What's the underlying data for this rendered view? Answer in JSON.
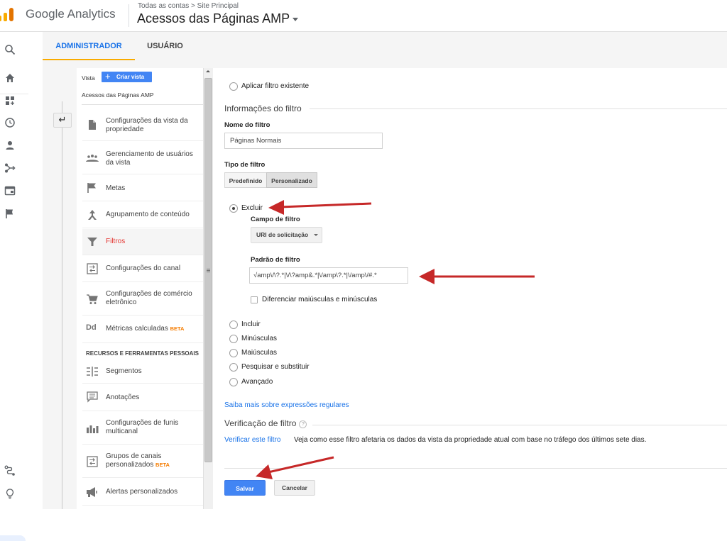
{
  "header": {
    "brand": "Google Analytics",
    "breadcrumb": "Todas as contas > Site Principal",
    "view_title": "Acessos das Páginas AMP"
  },
  "tabs": [
    {
      "label": "ADMINISTRADOR",
      "active": true
    },
    {
      "label": "USUÁRIO",
      "active": false
    }
  ],
  "rail": {
    "icons": [
      "search-icon",
      "home-icon",
      "customization-icon",
      "realtime-clock-icon",
      "audience-person-icon",
      "acquisition-icon",
      "behavior-icon",
      "conversions-flag-icon",
      "attribution-icon",
      "discover-lightbulb-icon"
    ]
  },
  "nav": {
    "vista_label": "Vista",
    "create_view_label": "Criar vista",
    "view_name": "Acessos das Páginas AMP",
    "back_icon": "back-arrow-icon",
    "items": [
      {
        "label": "Configurações da vista da propriedade",
        "icon": "document-icon"
      },
      {
        "label": "Gerenciamento de usuários da vista",
        "icon": "users-group-icon"
      },
      {
        "label": "Metas",
        "icon": "flag-icon"
      },
      {
        "label": "Agrupamento de conteúdo",
        "icon": "content-grouping-icon"
      },
      {
        "label": "Filtros",
        "icon": "filter-icon",
        "active": true
      },
      {
        "label": "Configurações do canal",
        "icon": "channel-settings-icon"
      },
      {
        "label": "Configurações de comércio eletrônico",
        "icon": "cart-icon"
      },
      {
        "label": "Métricas calculadas",
        "icon": "calculated-metrics-icon",
        "badge": "BETA"
      }
    ],
    "section_title": "RECURSOS E FERRAMENTAS PESSOAIS",
    "personal_items": [
      {
        "label": "Segmentos",
        "icon": "segments-icon"
      },
      {
        "label": "Anotações",
        "icon": "annotations-icon"
      },
      {
        "label": "Configurações de funis multicanal",
        "icon": "mcf-chart-icon"
      },
      {
        "label": "Grupos de canais personalizados",
        "icon": "channel-groups-icon",
        "badge": "BETA"
      },
      {
        "label": "Alertas personalizados",
        "icon": "megaphone-icon"
      }
    ]
  },
  "form": {
    "apply_existing_label": "Aplicar filtro existente",
    "info_section_title": "Informações do filtro",
    "filter_name_label": "Nome do filtro",
    "filter_name_value": "Páginas Normais",
    "filter_type_label": "Tipo de filtro",
    "filter_type_options": [
      "Predefinido",
      "Personalizado"
    ],
    "filter_type_selected": "Personalizado",
    "custom_options": [
      "Excluir",
      "Incluir",
      "Minúsculas",
      "Maiúsculas",
      "Pesquisar e substituir",
      "Avançado"
    ],
    "custom_selected": "Excluir",
    "filter_field_label": "Campo de filtro",
    "filter_field_value": "URI de solicitação",
    "filter_pattern_label": "Padrão de filtro",
    "filter_pattern_value": "\\/amp\\/\\?.*|\\/\\?amp&.*|\\/amp\\?.*|\\/amp\\/#.*",
    "filter_pattern_visible": "√amp\\/\\?.*|\\/\\?amp&.*|\\/amp\\?.*|\\/amp\\/#.*",
    "case_sensitive_label": "Diferenciar maiúsculas e minúsculas",
    "case_sensitive_checked": false,
    "regex_link": "Saiba mais sobre expressões regulares",
    "verification_title": "Verificação de filtro",
    "verify_link": "Verificar este filtro",
    "verify_description": "Veja como esse filtro afetaria os dados da vista da propriedade atual com base no tráfego dos últimos sete dias.",
    "save_label": "Salvar",
    "cancel_label": "Cancelar"
  },
  "colors": {
    "accent_blue": "#4285f4",
    "link_blue": "#1a73e8",
    "active_red": "#e53935",
    "tab_underline": "#f9ab00",
    "beta_orange": "#f57c00",
    "annotation_arrow": "#c62828"
  }
}
